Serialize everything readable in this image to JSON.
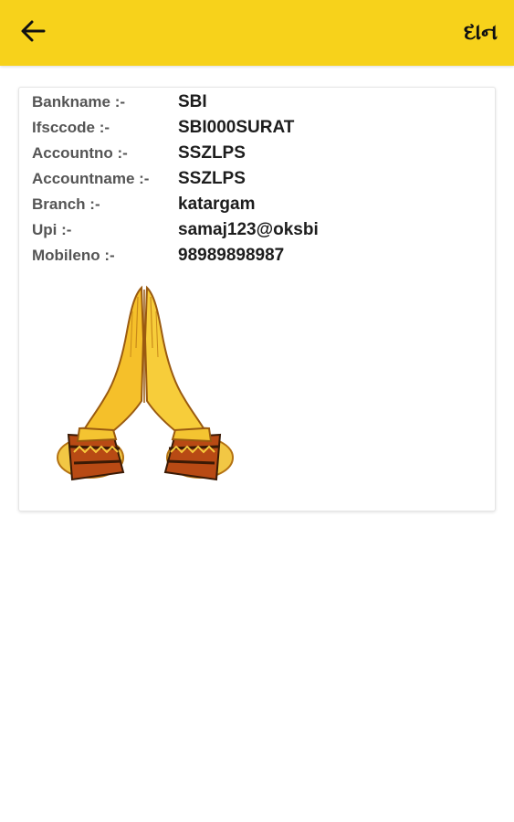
{
  "app_bar": {
    "title": "દાન",
    "back_icon": "arrow-left-icon",
    "background_color": "#f7d21b"
  },
  "bank_details": [
    {
      "label": "Bankname :-",
      "value": "SBI"
    },
    {
      "label": "Ifsccode :-",
      "value": "SBI000SURAT"
    },
    {
      "label": "Accountno :-",
      "value": "SSZLPS"
    },
    {
      "label": "Accountname :-",
      "value": "SSZLPS"
    },
    {
      "label": "Branch :-",
      "value": "katargam"
    },
    {
      "label": "Upi :-",
      "value": "samaj123@oksbi"
    },
    {
      "label": "Mobileno :-",
      "value": "98989898987"
    }
  ],
  "illustration": {
    "icon": "namaste-hands-icon"
  }
}
